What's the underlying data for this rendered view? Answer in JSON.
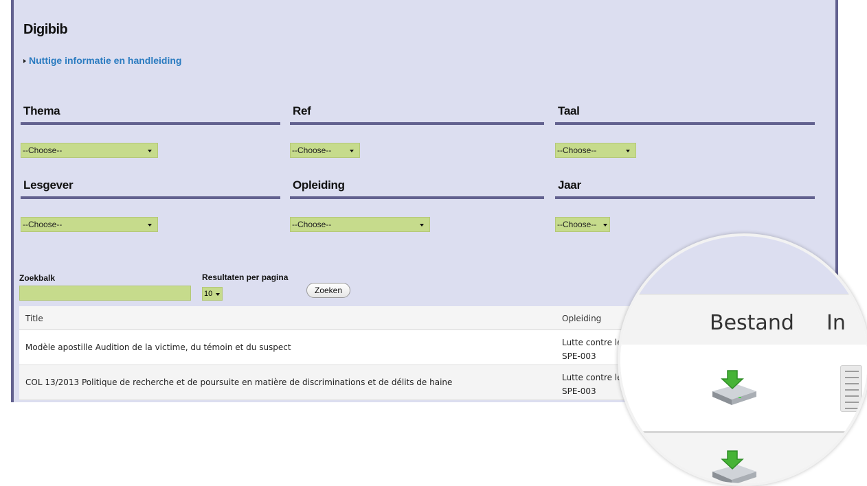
{
  "app": {
    "title": "Digibib",
    "info_link": "Nuttige informatie en handleiding"
  },
  "filters": [
    {
      "label": "Thema",
      "value": "--Choose--"
    },
    {
      "label": "Ref",
      "value": "--Choose--"
    },
    {
      "label": "Taal",
      "value": "--Choose--"
    },
    {
      "label": "Lesgever",
      "value": "--Choose--"
    },
    {
      "label": "Opleiding",
      "value": "--Choose--"
    },
    {
      "label": "Jaar",
      "value": "--Choose--"
    }
  ],
  "search": {
    "label": "Zoekbalk",
    "value": "",
    "rpp_label": "Resultaten per pagina",
    "rpp_value": "10",
    "button": "Zoeken"
  },
  "table": {
    "headers": {
      "title": "Title",
      "opleiding": "Opleiding"
    },
    "rows": [
      {
        "title": "Modèle apostille Audition de la victime, du témoin et du suspect",
        "opleiding": "Lutte contre le",
        "ref": "SPE-003"
      },
      {
        "title": "COL 13/2013 Politique de recherche et de poursuite en matière de discriminations et de délits de haine",
        "opleiding": "Lutte contre le",
        "ref": "SPE-003"
      }
    ]
  },
  "zoom": {
    "header_bestand": "Bestand",
    "header_in": "In",
    "icons": [
      "download-icon",
      "download-icon",
      "document-icon"
    ]
  },
  "colors": {
    "panel_bg": "#dcdef0",
    "accent": "#62618f",
    "select_bg": "#c6db8c",
    "link": "#2a7bc0"
  }
}
